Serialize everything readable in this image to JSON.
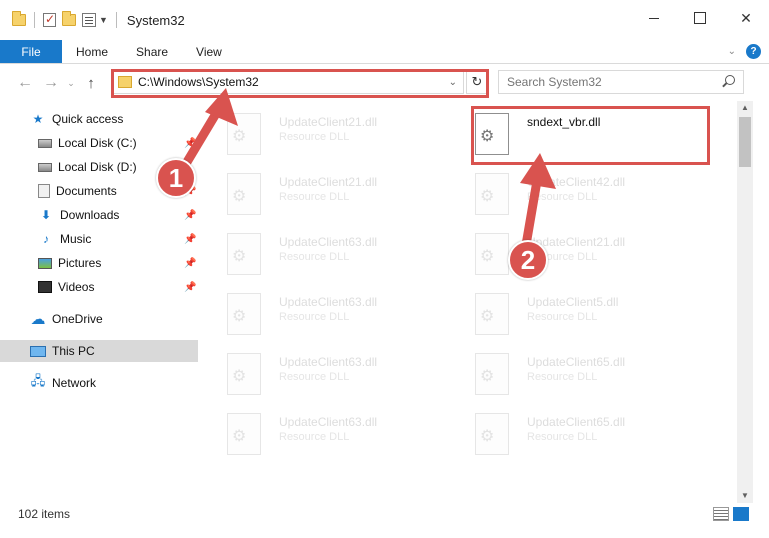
{
  "window": {
    "title": "System32"
  },
  "ribbon": {
    "tabs": [
      "File",
      "Home",
      "Share",
      "View"
    ]
  },
  "address": {
    "path": "C:\\Windows\\System32"
  },
  "search": {
    "placeholder": "Search System32"
  },
  "sidebar": {
    "items": [
      {
        "label": "Quick access",
        "icon": "star-icon",
        "pinned": false
      },
      {
        "label": "Local Disk (C:)",
        "icon": "disk-icon",
        "pinned": true
      },
      {
        "label": "Local Disk (D:)",
        "icon": "disk-icon",
        "pinned": false
      },
      {
        "label": "Documents",
        "icon": "documents-icon",
        "pinned": true
      },
      {
        "label": "Downloads",
        "icon": "download-icon",
        "pinned": true
      },
      {
        "label": "Music",
        "icon": "music-icon",
        "pinned": true
      },
      {
        "label": "Pictures",
        "icon": "pictures-icon",
        "pinned": true
      },
      {
        "label": "Videos",
        "icon": "videos-icon",
        "pinned": true
      },
      {
        "label": "OneDrive",
        "icon": "cloud-icon",
        "pinned": false
      },
      {
        "label": "This PC",
        "icon": "pc-icon",
        "pinned": false,
        "selected": true
      },
      {
        "label": "Network",
        "icon": "network-icon",
        "pinned": false
      }
    ]
  },
  "files": {
    "left": [
      {
        "name": "UpdateClient21.dll",
        "type": "Resource DLL"
      },
      {
        "name": "UpdateClient21.dll",
        "type": "Resource DLL"
      },
      {
        "name": "UpdateClient63.dll",
        "type": "Resource DLL"
      },
      {
        "name": "UpdateClient63.dll",
        "type": "Resource DLL"
      },
      {
        "name": "UpdateClient63.dll",
        "type": "Resource DLL"
      },
      {
        "name": "UpdateClient63.dll",
        "type": "Resource DLL"
      }
    ],
    "right": [
      {
        "name": "sndext_vbr.dll",
        "type": "",
        "active": true
      },
      {
        "name": "UpdateClient42.dll",
        "type": "Resource DLL"
      },
      {
        "name": "UpdateClient21.dll",
        "type": "Resource DLL"
      },
      {
        "name": "UpdateClient5.dll",
        "type": "Resource DLL"
      },
      {
        "name": "UpdateClient65.dll",
        "type": "Resource DLL"
      },
      {
        "name": "UpdateClient65.dll",
        "type": "Resource DLL"
      }
    ]
  },
  "annotations": {
    "step1": "1",
    "step2": "2",
    "color": "#d9534f"
  },
  "status": {
    "item_count": "102 items"
  }
}
